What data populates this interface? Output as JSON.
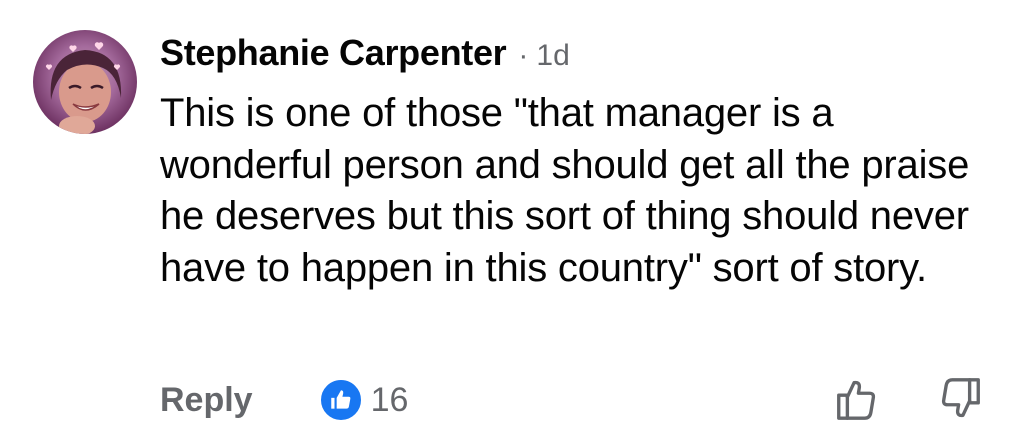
{
  "comment": {
    "author": "Stephanie Carpenter",
    "separator": "·",
    "timestamp": "1d",
    "text": "This is one of those \"that manager is a wonderful person and should get all the praise he deserves but this sort of thing should never have to happen in this country\" sort of story.",
    "avatar_icon": "profile-photo"
  },
  "actions": {
    "reply_label": "Reply",
    "reaction_icon": "like-thumbs-up-icon",
    "reaction_color": "#1877f2",
    "reaction_count": "16",
    "upvote_icon": "thumbs-up-outline-icon",
    "downvote_icon": "thumbs-down-outline-icon"
  }
}
